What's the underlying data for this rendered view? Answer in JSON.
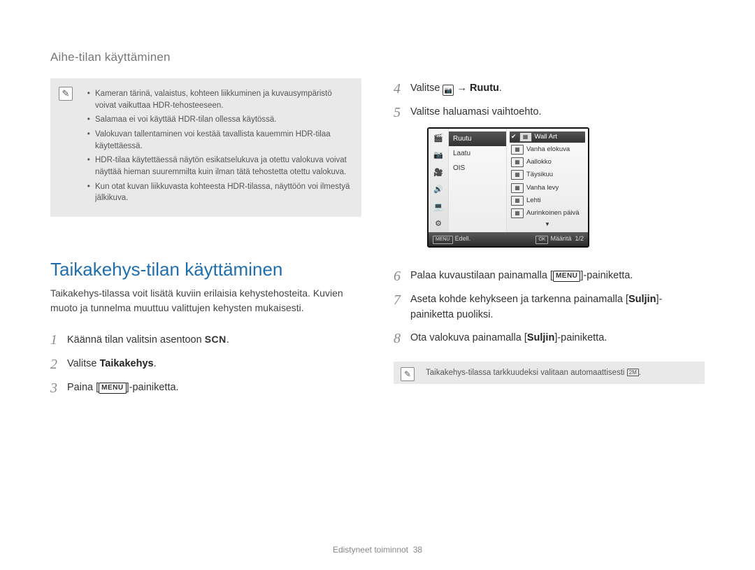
{
  "breadcrumb": "Aihe-tilan käyttäminen",
  "note": {
    "items": [
      "Kameran tärinä, valaistus, kohteen liikkuminen ja kuvausympäristö voivat vaikuttaa HDR-tehosteeseen.",
      "Salamaa ei voi käyttää HDR-tilan ollessa käytössä.",
      "Valokuvan tallentaminen voi kestää tavallista kauemmin HDR-tilaa käytettäessä.",
      "HDR-tilaa käytettäessä näytön esikatselukuva ja otettu valokuva voivat näyttää hieman suuremmilta kuin ilman tätä tehostetta otettu valokuva.",
      "Kun otat kuvan liikkuvasta kohteesta HDR-tilassa, näyttöön voi ilmestyä jälkikuva."
    ]
  },
  "section": {
    "title": "Taikakehys-tilan käyttäminen",
    "desc": "Taikakehys-tilassa voit lisätä kuviin erilaisia kehystehosteita. Kuvien muoto ja tunnelma muuttuu valittujen kehysten mukaisesti."
  },
  "steps_left": {
    "s1_pre": "Käännä tilan valitsin asentoon ",
    "s1_scn": "SCN",
    "s1_post": ".",
    "s2_pre": "Valitse ",
    "s2_bold": "Taikakehys",
    "s2_post": ".",
    "s3_pre": "Paina [",
    "s3_menu": "MENU",
    "s3_post": "]-painiketta."
  },
  "steps_right": {
    "s4_pre": "Valitse ",
    "s4_arrow": " → ",
    "s4_bold": "Ruutu",
    "s4_post": ".",
    "s5": "Valitse haluamasi vaihtoehto.",
    "s6_pre": "Palaa kuvaustilaan painamalla [",
    "s6_menu": "MENU",
    "s6_post": "]-painiketta.",
    "s7_pre": "Aseta kohde kehykseen ja tarkenna painamalla [",
    "s7_bold": "Suljin",
    "s7_mid": "]-painiketta puoliksi.",
    "s8_pre": "Ota valokuva painamalla [",
    "s8_bold": "Suljin",
    "s8_post": "]-painiketta."
  },
  "cam": {
    "left": {
      "ruutu": "Ruutu",
      "laatu": "Laatu",
      "ois": "OIS"
    },
    "opts": {
      "wall": "Wall Art",
      "vanhae": "Vanha elokuva",
      "aallokko": "Aallokko",
      "tays": "Täysikuu",
      "vanhal": "Vanha levy",
      "lehti": "Lehti",
      "aurinko": "Aurinkoinen päivä"
    },
    "footer": {
      "menu": "MENU",
      "edell": "Edell.",
      "ok": "OK",
      "maarita": "Määritä",
      "page": "1/2"
    }
  },
  "tip": {
    "text_pre": "Taikakehys-tilassa tarkkuudeksi valitaan automaattisesti ",
    "badge": "2M",
    "text_post": "."
  },
  "footer": {
    "label": "Edistyneet toiminnot",
    "page": "38"
  }
}
